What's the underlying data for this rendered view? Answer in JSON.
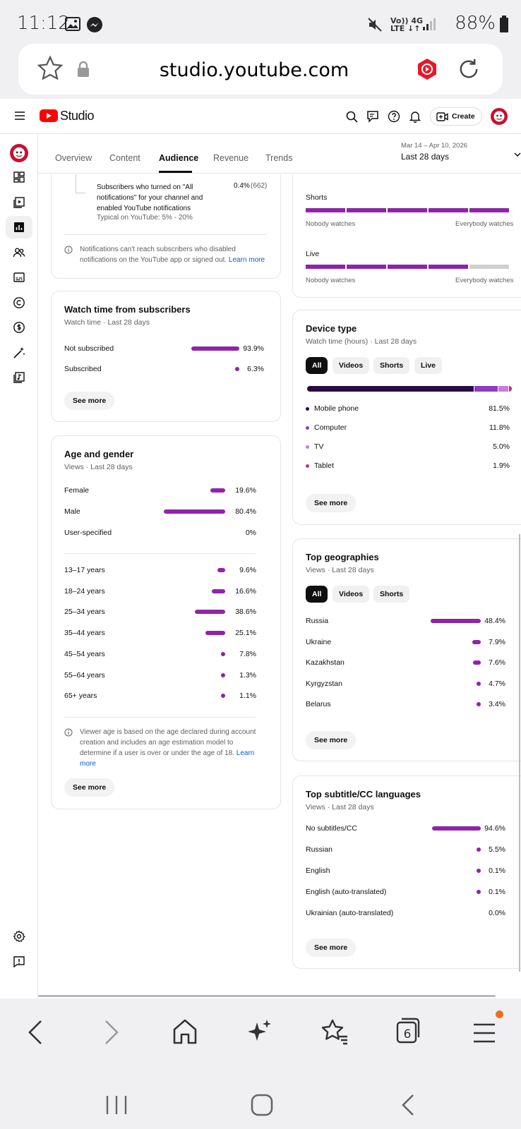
{
  "status_bar": {
    "time": "11:12",
    "battery": "88%",
    "network_top": "Vo)) 4G",
    "network_bottom": "LTE ↓↑"
  },
  "browser": {
    "url": "studio.youtube.com",
    "tab_count": "6"
  },
  "header": {
    "logo_text": "Studio",
    "create_label": "Create"
  },
  "tabs": [
    {
      "label": "Overview"
    },
    {
      "label": "Content"
    },
    {
      "label": "Audience"
    },
    {
      "label": "Revenue"
    },
    {
      "label": "Trends"
    }
  ],
  "date_range": {
    "range": "Mar 14 – Apr 10, 2026",
    "label": "Last 28 days"
  },
  "notifications_card": {
    "row_text": "Subscribers who turned on \"All notifications\" for your channel and enabled YouTube notifications",
    "typical": "Typical on YouTube: 5% - 20%",
    "value": "0.4%",
    "count": "(662)",
    "note": "Notifications can't reach subscribers who disabled notifications on the YouTube app or signed out.",
    "learn_more": "Learn more"
  },
  "watch_time_subs": {
    "title": "Watch time from subscribers",
    "subtitle": "Watch time · Last 28 days",
    "rows": [
      {
        "label": "Not subscribed",
        "value": "93.9%",
        "pct": 93.9
      },
      {
        "label": "Subscribed",
        "value": "6.3%",
        "pct": 6.3
      }
    ],
    "see_more": "See more"
  },
  "age_gender": {
    "title": "Age and gender",
    "subtitle": "Views · Last 28 days",
    "gender": [
      {
        "label": "Female",
        "value": "19.6%",
        "pct": 19.6
      },
      {
        "label": "Male",
        "value": "80.4%",
        "pct": 80.4
      },
      {
        "label": "User-specified",
        "value": "0%",
        "pct": 0
      }
    ],
    "ages": [
      {
        "label": "13–17 years",
        "value": "9.6%",
        "pct": 9.6
      },
      {
        "label": "18–24 years",
        "value": "16.6%",
        "pct": 16.6
      },
      {
        "label": "25–34 years",
        "value": "38.6%",
        "pct": 38.6
      },
      {
        "label": "35–44 years",
        "value": "25.1%",
        "pct": 25.1
      },
      {
        "label": "45–54 years",
        "value": "7.8%",
        "pct": 7.8
      },
      {
        "label": "55–64 years",
        "value": "1.3%",
        "pct": 1.3
      },
      {
        "label": "65+ years",
        "value": "1.1%",
        "pct": 1.1
      }
    ],
    "note": "Viewer age is based on the age declared during account creation and includes an age estimation model to determine if a user is over or under the age of 18.",
    "learn_more": "Learn more",
    "see_more": "See more"
  },
  "viewer_scales": {
    "items": [
      {
        "label": "Shorts",
        "filled_segments": 5,
        "total_segments": 5
      },
      {
        "label": "Live",
        "filled_segments": 4,
        "total_segments": 5
      }
    ],
    "left_label": "Nobody watches",
    "right_label": "Everybody watches"
  },
  "device_type": {
    "title": "Device type",
    "subtitle": "Watch time (hours) · Last 28 days",
    "chips": [
      "All",
      "Videos",
      "Shorts",
      "Live"
    ],
    "rows": [
      {
        "label": "Mobile phone",
        "value": "81.5%",
        "pct": 81.5,
        "color": "#2a0a40"
      },
      {
        "label": "Computer",
        "value": "11.8%",
        "pct": 11.8,
        "color": "#8e3cc2"
      },
      {
        "label": "TV",
        "value": "5.0%",
        "pct": 5.0,
        "color": "#c77ddc"
      },
      {
        "label": "Tablet",
        "value": "1.9%",
        "pct": 1.9,
        "color": "#c2307f"
      }
    ],
    "see_more": "See more"
  },
  "top_geographies": {
    "title": "Top geographies",
    "subtitle": "Views · Last 28 days",
    "chips": [
      "All",
      "Videos",
      "Shorts"
    ],
    "rows": [
      {
        "label": "Russia",
        "value": "48.4%",
        "pct": 48.4
      },
      {
        "label": "Ukraine",
        "value": "7.9%",
        "pct": 7.9
      },
      {
        "label": "Kazakhstan",
        "value": "7.6%",
        "pct": 7.6
      },
      {
        "label": "Kyrgyzstan",
        "value": "4.7%",
        "pct": 4.7
      },
      {
        "label": "Belarus",
        "value": "3.4%",
        "pct": 3.4
      }
    ],
    "see_more": "See more"
  },
  "subtitle_langs": {
    "title": "Top subtitle/CC languages",
    "subtitle": "Views · Last 28 days",
    "rows": [
      {
        "label": "No subtitles/CC",
        "value": "94.6%",
        "pct": 94.6
      },
      {
        "label": "Russian",
        "value": "5.5%",
        "pct": 5.5
      },
      {
        "label": "English",
        "value": "0.1%",
        "pct": 0.1
      },
      {
        "label": "English (auto-translated)",
        "value": "0.1%",
        "pct": 0.1
      },
      {
        "label": "Ukrainian (auto-translated)",
        "value": "0.0%",
        "pct": 0.0
      }
    ],
    "see_more": "See more"
  },
  "colors": {
    "accent": "#8e24aa",
    "youtube_red": "#ff0000",
    "link": "#065fd4"
  }
}
